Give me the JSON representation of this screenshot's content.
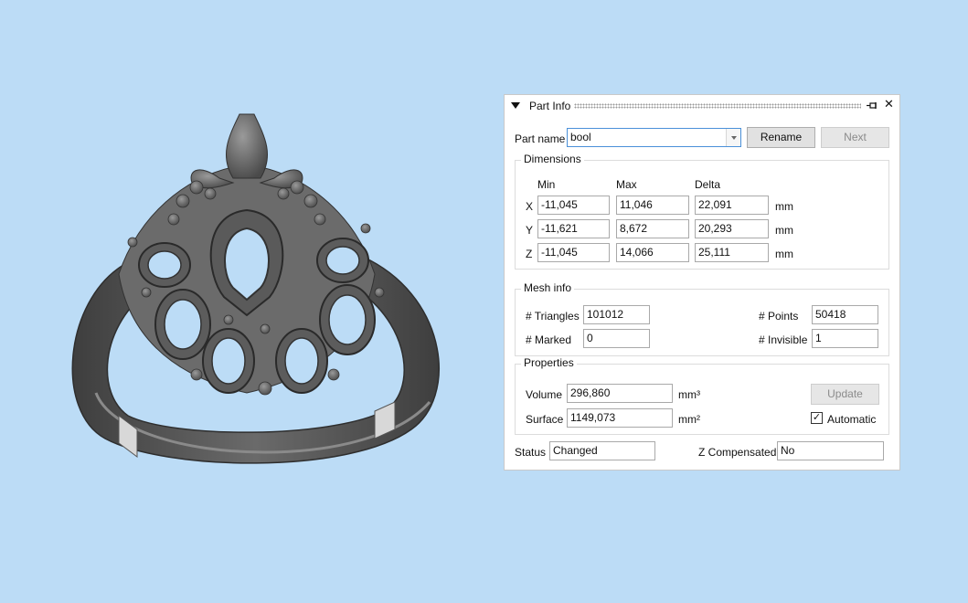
{
  "panel": {
    "title": "Part Info",
    "icons": {
      "collapse": "triangle-down-icon",
      "pin": "pin-icon",
      "close": "close-icon"
    },
    "close_glyph": "✕",
    "part_name_label": "Part name",
    "part_name_value": "bool",
    "rename_label": "Rename",
    "next_label": "Next"
  },
  "dimensions": {
    "title": "Dimensions",
    "headers": {
      "min": "Min",
      "max": "Max",
      "delta": "Delta"
    },
    "rows": [
      {
        "axis": "X",
        "min": "-11,045",
        "max": "11,046",
        "delta": "22,091",
        "unit": "mm"
      },
      {
        "axis": "Y",
        "min": "-11,621",
        "max": "8,672",
        "delta": "20,293",
        "unit": "mm"
      },
      {
        "axis": "Z",
        "min": "-11,045",
        "max": "14,066",
        "delta": "25,111",
        "unit": "mm"
      }
    ]
  },
  "mesh": {
    "title": "Mesh info",
    "triangles_label": "# Triangles",
    "triangles_value": "101012",
    "points_label": "# Points",
    "points_value": "50418",
    "marked_label": "# Marked",
    "marked_value": "0",
    "invisible_label": "# Invisible",
    "invisible_value": "1"
  },
  "properties": {
    "title": "Properties",
    "volume_label": "Volume",
    "volume_value": "296,860",
    "volume_unit": "mm³",
    "surface_label": "Surface",
    "surface_value": "1149,073",
    "surface_unit": "mm²",
    "update_label": "Update",
    "automatic_label": "Automatic",
    "automatic_checked": true,
    "check_glyph": "✓"
  },
  "status": {
    "label": "Status",
    "value": "Changed",
    "zcomp_label": "Z Compensated",
    "zcomp_value": "No"
  },
  "colors": {
    "background": "#bcdcf6",
    "ring": "#5a5a5a",
    "accent": "#4a90d9"
  }
}
